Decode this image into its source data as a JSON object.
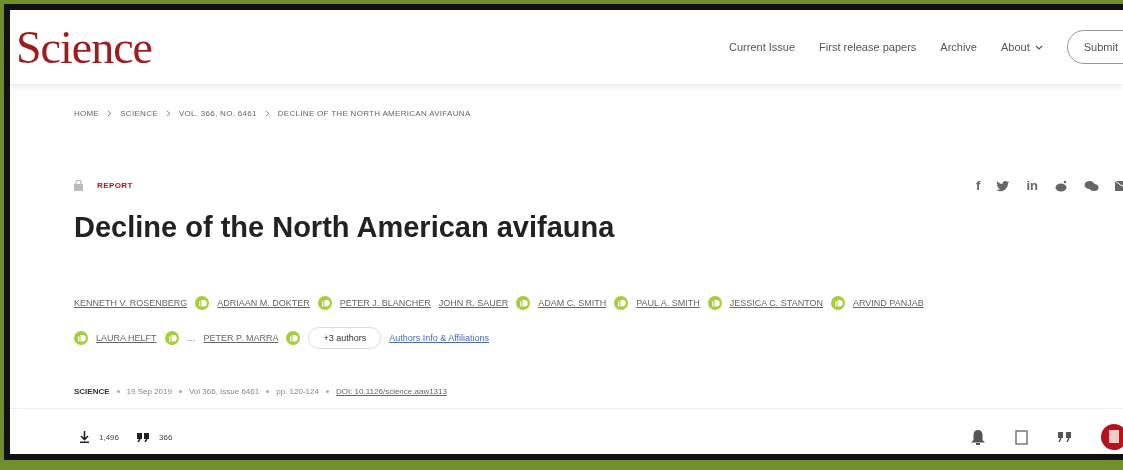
{
  "header": {
    "logo": "Science",
    "nav": [
      {
        "label": "Current Issue",
        "dropdown": false
      },
      {
        "label": "First release papers",
        "dropdown": false
      },
      {
        "label": "Archive",
        "dropdown": false
      },
      {
        "label": "About",
        "dropdown": true
      }
    ],
    "submit": "Submit"
  },
  "breadcrumb": [
    "HOME",
    "SCIENCE",
    "VOL. 366, NO. 6461",
    "DECLINE OF THE NORTH AMERICAN AVIFAUNA"
  ],
  "article_type": "REPORT",
  "share": [
    {
      "kind": "text",
      "text": "f"
    },
    {
      "kind": "bird"
    },
    {
      "kind": "text",
      "text": "in"
    },
    {
      "kind": "alien"
    },
    {
      "kind": "chat"
    },
    {
      "kind": "mail"
    }
  ],
  "title": "Decline of the North American avifauna",
  "author_lines": [
    [
      {
        "kind": "name",
        "text": "KENNETH V. ROSENBERG"
      },
      {
        "kind": "orcid"
      },
      {
        "kind": "name",
        "text": "ADRIAAN M. DOKTER"
      },
      {
        "kind": "orcid"
      },
      {
        "kind": "name",
        "text": "PETER J. BLANCHER"
      },
      {
        "kind": "name",
        "text": "JOHN R. SAUER"
      },
      {
        "kind": "orcid"
      },
      {
        "kind": "name",
        "text": "ADAM C. SMITH"
      },
      {
        "kind": "orcid"
      },
      {
        "kind": "name",
        "text": "PAUL A. SMITH"
      },
      {
        "kind": "orcid"
      },
      {
        "kind": "name",
        "text": "JESSICA C. STANTON"
      },
      {
        "kind": "orcid"
      },
      {
        "kind": "name",
        "text": "ARVIND PANJAB"
      }
    ],
    [
      {
        "kind": "orcid"
      },
      {
        "kind": "name",
        "text": "LAURA HELFT"
      },
      {
        "kind": "orcid"
      },
      {
        "kind": "sep",
        "text": "…"
      },
      {
        "kind": "name",
        "text": "PETER P. MARRA"
      },
      {
        "kind": "orcid"
      },
      {
        "kind": "more",
        "text": "+3 authors"
      },
      {
        "kind": "link",
        "text": "Authors Info & Affiliations"
      }
    ]
  ],
  "meta": {
    "journal": "SCIENCE",
    "items": [
      "19 Sep 2019",
      "Vol 366, Issue 6461",
      "pp. 120-124"
    ],
    "doi": "DOI: 10.1126/science.aaw1313"
  },
  "metrics": [
    {
      "kind": "download",
      "value": "1,496"
    },
    {
      "kind": "quote",
      "value": "366"
    }
  ],
  "actions": [
    {
      "kind": "bell"
    },
    {
      "kind": "bookmark"
    },
    {
      "kind": "quote"
    },
    {
      "kind": "pdf"
    }
  ]
}
